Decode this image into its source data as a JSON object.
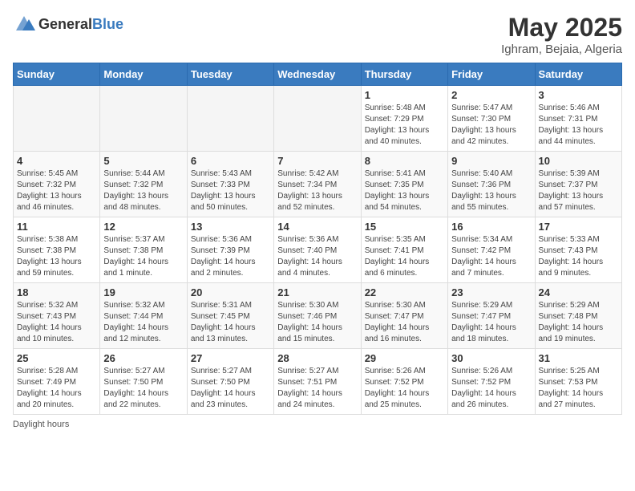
{
  "header": {
    "logo_general": "General",
    "logo_blue": "Blue",
    "title": "May 2025",
    "subtitle": "Ighram, Bejaia, Algeria"
  },
  "days_of_week": [
    "Sunday",
    "Monday",
    "Tuesday",
    "Wednesday",
    "Thursday",
    "Friday",
    "Saturday"
  ],
  "weeks": [
    [
      {
        "day": "",
        "info": ""
      },
      {
        "day": "",
        "info": ""
      },
      {
        "day": "",
        "info": ""
      },
      {
        "day": "",
        "info": ""
      },
      {
        "day": "1",
        "info": "Sunrise: 5:48 AM\nSunset: 7:29 PM\nDaylight: 13 hours\nand 40 minutes."
      },
      {
        "day": "2",
        "info": "Sunrise: 5:47 AM\nSunset: 7:30 PM\nDaylight: 13 hours\nand 42 minutes."
      },
      {
        "day": "3",
        "info": "Sunrise: 5:46 AM\nSunset: 7:31 PM\nDaylight: 13 hours\nand 44 minutes."
      }
    ],
    [
      {
        "day": "4",
        "info": "Sunrise: 5:45 AM\nSunset: 7:32 PM\nDaylight: 13 hours\nand 46 minutes."
      },
      {
        "day": "5",
        "info": "Sunrise: 5:44 AM\nSunset: 7:32 PM\nDaylight: 13 hours\nand 48 minutes."
      },
      {
        "day": "6",
        "info": "Sunrise: 5:43 AM\nSunset: 7:33 PM\nDaylight: 13 hours\nand 50 minutes."
      },
      {
        "day": "7",
        "info": "Sunrise: 5:42 AM\nSunset: 7:34 PM\nDaylight: 13 hours\nand 52 minutes."
      },
      {
        "day": "8",
        "info": "Sunrise: 5:41 AM\nSunset: 7:35 PM\nDaylight: 13 hours\nand 54 minutes."
      },
      {
        "day": "9",
        "info": "Sunrise: 5:40 AM\nSunset: 7:36 PM\nDaylight: 13 hours\nand 55 minutes."
      },
      {
        "day": "10",
        "info": "Sunrise: 5:39 AM\nSunset: 7:37 PM\nDaylight: 13 hours\nand 57 minutes."
      }
    ],
    [
      {
        "day": "11",
        "info": "Sunrise: 5:38 AM\nSunset: 7:38 PM\nDaylight: 13 hours\nand 59 minutes."
      },
      {
        "day": "12",
        "info": "Sunrise: 5:37 AM\nSunset: 7:38 PM\nDaylight: 14 hours\nand 1 minute."
      },
      {
        "day": "13",
        "info": "Sunrise: 5:36 AM\nSunset: 7:39 PM\nDaylight: 14 hours\nand 2 minutes."
      },
      {
        "day": "14",
        "info": "Sunrise: 5:36 AM\nSunset: 7:40 PM\nDaylight: 14 hours\nand 4 minutes."
      },
      {
        "day": "15",
        "info": "Sunrise: 5:35 AM\nSunset: 7:41 PM\nDaylight: 14 hours\nand 6 minutes."
      },
      {
        "day": "16",
        "info": "Sunrise: 5:34 AM\nSunset: 7:42 PM\nDaylight: 14 hours\nand 7 minutes."
      },
      {
        "day": "17",
        "info": "Sunrise: 5:33 AM\nSunset: 7:43 PM\nDaylight: 14 hours\nand 9 minutes."
      }
    ],
    [
      {
        "day": "18",
        "info": "Sunrise: 5:32 AM\nSunset: 7:43 PM\nDaylight: 14 hours\nand 10 minutes."
      },
      {
        "day": "19",
        "info": "Sunrise: 5:32 AM\nSunset: 7:44 PM\nDaylight: 14 hours\nand 12 minutes."
      },
      {
        "day": "20",
        "info": "Sunrise: 5:31 AM\nSunset: 7:45 PM\nDaylight: 14 hours\nand 13 minutes."
      },
      {
        "day": "21",
        "info": "Sunrise: 5:30 AM\nSunset: 7:46 PM\nDaylight: 14 hours\nand 15 minutes."
      },
      {
        "day": "22",
        "info": "Sunrise: 5:30 AM\nSunset: 7:47 PM\nDaylight: 14 hours\nand 16 minutes."
      },
      {
        "day": "23",
        "info": "Sunrise: 5:29 AM\nSunset: 7:47 PM\nDaylight: 14 hours\nand 18 minutes."
      },
      {
        "day": "24",
        "info": "Sunrise: 5:29 AM\nSunset: 7:48 PM\nDaylight: 14 hours\nand 19 minutes."
      }
    ],
    [
      {
        "day": "25",
        "info": "Sunrise: 5:28 AM\nSunset: 7:49 PM\nDaylight: 14 hours\nand 20 minutes."
      },
      {
        "day": "26",
        "info": "Sunrise: 5:27 AM\nSunset: 7:50 PM\nDaylight: 14 hours\nand 22 minutes."
      },
      {
        "day": "27",
        "info": "Sunrise: 5:27 AM\nSunset: 7:50 PM\nDaylight: 14 hours\nand 23 minutes."
      },
      {
        "day": "28",
        "info": "Sunrise: 5:27 AM\nSunset: 7:51 PM\nDaylight: 14 hours\nand 24 minutes."
      },
      {
        "day": "29",
        "info": "Sunrise: 5:26 AM\nSunset: 7:52 PM\nDaylight: 14 hours\nand 25 minutes."
      },
      {
        "day": "30",
        "info": "Sunrise: 5:26 AM\nSunset: 7:52 PM\nDaylight: 14 hours\nand 26 minutes."
      },
      {
        "day": "31",
        "info": "Sunrise: 5:25 AM\nSunset: 7:53 PM\nDaylight: 14 hours\nand 27 minutes."
      }
    ]
  ],
  "footer": {
    "note": "Daylight hours"
  }
}
